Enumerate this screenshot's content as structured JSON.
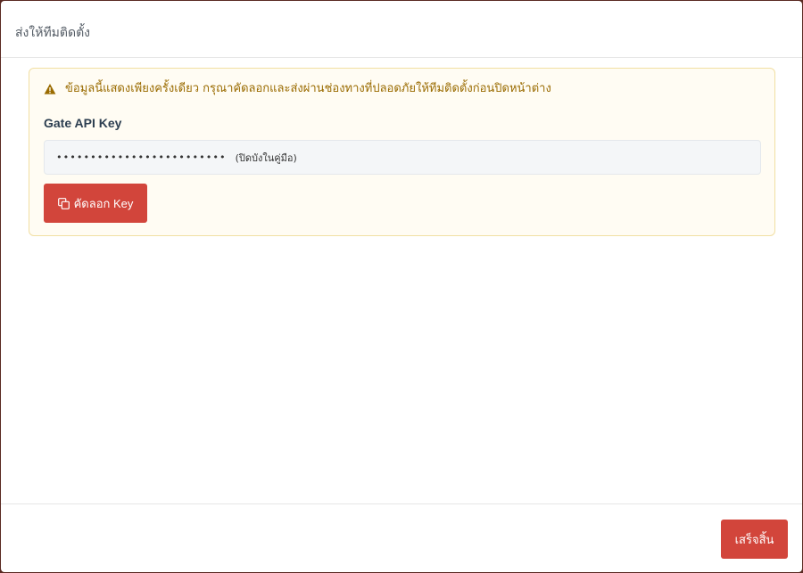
{
  "modal": {
    "title": "ส่งให้ทีมติดตั้ง"
  },
  "alert": {
    "icon": "warning-icon",
    "message": "ข้อมูลนี้แสดงเพียงครั้งเดียว กรุณาคัดลอกและส่งผ่านช่องทางที่ปลอดภัยให้ทีมติดตั้งก่อนปิดหน้าต่าง",
    "color": "#9a6b00"
  },
  "key": {
    "label": "Gate API Key",
    "masked_value": "•••••••••••••••••••••••••",
    "note": "(ปิดบังในคู่มือ)"
  },
  "buttons": {
    "copy_icon": "copy-icon",
    "copy_label": "คัดลอก Key",
    "done_label": "เสร็จสิ้น",
    "accent": "#d2453b"
  }
}
